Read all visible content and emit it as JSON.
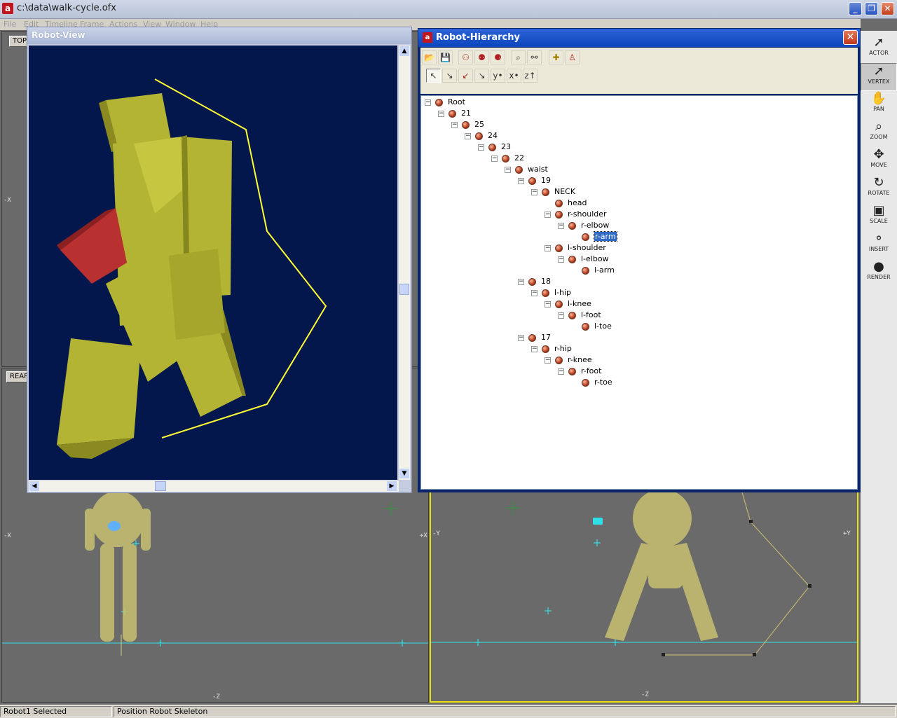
{
  "app": {
    "title": "c:\\data\\walk-cycle.ofx",
    "icon": "app-logo-icon",
    "minimize": "_",
    "maximize": "❐",
    "close": "✕"
  },
  "menubar": [
    "File",
    "Edit",
    "Timeline",
    "Frame",
    "Actions",
    "View",
    "Window",
    "Help"
  ],
  "viewports": {
    "top_label": "TOP",
    "rear_label": "REAR",
    "axis_neg_x": "-X",
    "axis_pos_x": "+X",
    "axis_neg_y": "-Y",
    "axis_pos_y": "+Y",
    "axis_neg_z_left": "-Z",
    "axis_neg_z_right": "-Z"
  },
  "robot_view": {
    "title": "Robot-View"
  },
  "robot_hierarchy": {
    "title": "Robot-Hierarchy",
    "close": "✕",
    "toolbar_row1": [
      "open-icon",
      "save-icon",
      "skeleton-icon",
      "skeleton-alt-icon",
      "skeleton-grid-icon",
      "zoom-icon",
      "graph-icon",
      "add-icon",
      "figure-icon"
    ],
    "toolbar_row2": [
      "↖",
      "↘",
      "↙",
      "↘",
      "y•",
      "x•",
      "z↑"
    ],
    "tree": [
      {
        "label": "Root",
        "depth": 0,
        "expanded": true
      },
      {
        "label": "21",
        "depth": 1,
        "expanded": true
      },
      {
        "label": "25",
        "depth": 2,
        "expanded": true
      },
      {
        "label": "24",
        "depth": 3,
        "expanded": true
      },
      {
        "label": "23",
        "depth": 4,
        "expanded": true
      },
      {
        "label": "22",
        "depth": 5,
        "expanded": true
      },
      {
        "label": "waist",
        "depth": 6,
        "expanded": true
      },
      {
        "label": "19",
        "depth": 7,
        "expanded": true
      },
      {
        "label": "NECK",
        "depth": 8,
        "expanded": true
      },
      {
        "label": "head",
        "depth": 9,
        "expanded": null
      },
      {
        "label": "r-shoulder",
        "depth": 9,
        "expanded": true
      },
      {
        "label": "r-elbow",
        "depth": 10,
        "expanded": true
      },
      {
        "label": "r-arm",
        "depth": 11,
        "expanded": null,
        "selected": true
      },
      {
        "label": "l-shoulder",
        "depth": 9,
        "expanded": true
      },
      {
        "label": "l-elbow",
        "depth": 10,
        "expanded": true
      },
      {
        "label": "l-arm",
        "depth": 11,
        "expanded": null
      },
      {
        "label": "18",
        "depth": 7,
        "expanded": true
      },
      {
        "label": "l-hip",
        "depth": 8,
        "expanded": true
      },
      {
        "label": "l-knee",
        "depth": 9,
        "expanded": true
      },
      {
        "label": "l-foot",
        "depth": 10,
        "expanded": true
      },
      {
        "label": "l-toe",
        "depth": 11,
        "expanded": null
      },
      {
        "label": "17",
        "depth": 7,
        "expanded": true
      },
      {
        "label": "r-hip",
        "depth": 8,
        "expanded": true
      },
      {
        "label": "r-knee",
        "depth": 9,
        "expanded": true
      },
      {
        "label": "r-foot",
        "depth": 10,
        "expanded": true
      },
      {
        "label": "r-toe",
        "depth": 11,
        "expanded": null
      }
    ]
  },
  "palette": [
    {
      "label": "ACTOR",
      "icon": "arrow-cursor-icon",
      "key": "O"
    },
    {
      "label": "VERTEX",
      "icon": "vertex-cursor-icon",
      "key": "V",
      "active": true
    },
    {
      "label": "PAN",
      "icon": "hand-icon",
      "key": "P"
    },
    {
      "label": "ZOOM",
      "icon": "magnifier-icon",
      "key": "Z"
    },
    {
      "label": "MOVE",
      "icon": "move-icon",
      "key": "M"
    },
    {
      "label": "ROTATE",
      "icon": "rotate-icon",
      "key": "R"
    },
    {
      "label": "SCALE",
      "icon": "scale-icon",
      "key": "S"
    },
    {
      "label": "INSERT",
      "icon": "insert-icon",
      "key": ""
    },
    {
      "label": "RENDER",
      "icon": "render-icon",
      "key": ""
    }
  ],
  "status": {
    "selection": "Robot1 Selected",
    "info": "Position  Robot Skeleton"
  },
  "colors": {
    "robot_view_bg": "#04174c",
    "robot_body": "#b4b434",
    "robot_arm": "#b83030",
    "path_line": "#ffff33",
    "ground_line": "#2fe0e8"
  }
}
